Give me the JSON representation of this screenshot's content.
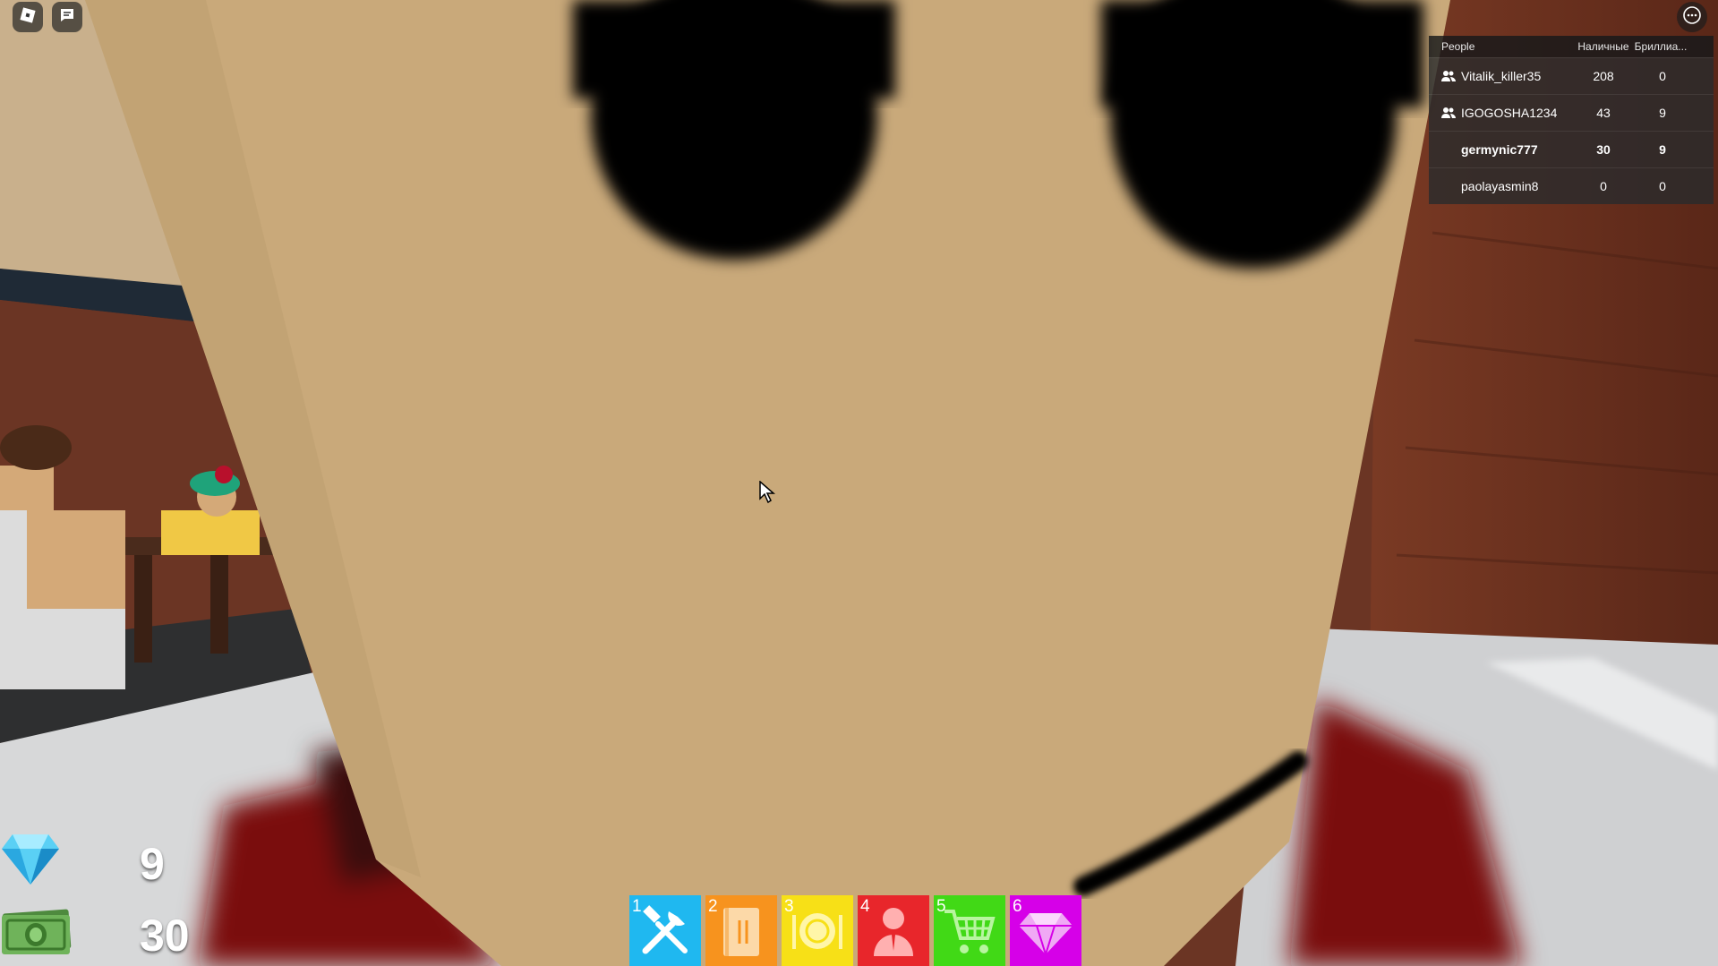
{
  "leaderboard": {
    "header": {
      "people": "People",
      "cash": "Наличные",
      "gems": "Бриллиа..."
    },
    "rows": [
      {
        "name": "Vitalik_killer35",
        "cash": "208",
        "gems": "0",
        "friend": true,
        "me": false
      },
      {
        "name": "IGOGOSHA1234",
        "cash": "43",
        "gems": "9",
        "friend": true,
        "me": false
      },
      {
        "name": "germynic777",
        "cash": "30",
        "gems": "9",
        "friend": false,
        "me": true
      },
      {
        "name": "paolayasmin8",
        "cash": "0",
        "gems": "0",
        "friend": false,
        "me": false
      }
    ]
  },
  "currency": {
    "gems": "9",
    "cash": "30"
  },
  "hotbar": [
    {
      "num": "1",
      "icon": "tools-icon",
      "color": "#1fb8f0"
    },
    {
      "num": "2",
      "icon": "menu-book-icon",
      "color": "#f7931e"
    },
    {
      "num": "3",
      "icon": "plate-cutlery-icon",
      "color": "#f7e017"
    },
    {
      "num": "4",
      "icon": "staff-person-icon",
      "color": "#e8262b"
    },
    {
      "num": "5",
      "icon": "shopping-cart-icon",
      "color": "#41d916"
    },
    {
      "num": "6",
      "icon": "diamond-icon",
      "color": "#d600e8"
    }
  ],
  "colors": {
    "skin": "#c9a97a",
    "eye": "#000000",
    "wall": "#6b3524"
  }
}
